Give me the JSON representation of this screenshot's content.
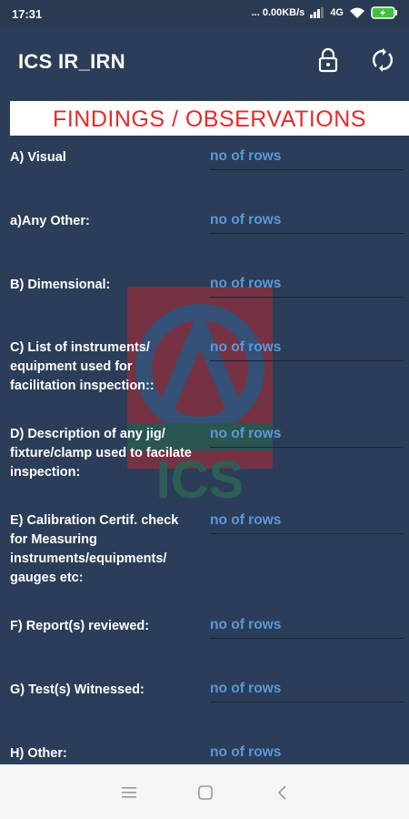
{
  "status_bar": {
    "time": "17:31",
    "network_speed": "... 0.00KB/s",
    "network_type": "4G"
  },
  "app_bar": {
    "title": "ICS IR_IRN",
    "actions": [
      "lock-icon",
      "sync-icon"
    ]
  },
  "banner": {
    "text": "FINDINGS / OBSERVATIONS",
    "color": "#e42b2b"
  },
  "fields": [
    {
      "label": "A) Visual",
      "link": "no of rows"
    },
    {
      "label": "a)Any Other:",
      "link": "no of rows"
    },
    {
      "label": "B) Dimensional:",
      "link": "no of rows"
    },
    {
      "label": "C) List of instruments/ equipment used for facilitation inspection::",
      "link": "no of rows"
    },
    {
      "label": "D) Description of any jig/ fixture/clamp used to facilate inspection:",
      "link": "no of rows"
    },
    {
      "label": "E) Calibration Certif. check for Measuring instruments/equipments/ gauges etc:",
      "link": "no of rows"
    },
    {
      "label": "F) Report(s) reviewed:",
      "link": "no of rows"
    },
    {
      "label": "G) Test(s) Witnessed:",
      "link": "no of rows"
    },
    {
      "label": "H) Other:",
      "link": "no of rows"
    }
  ],
  "watermark": {
    "text": "ICS"
  },
  "nav_bar": {
    "buttons": [
      "menu-icon",
      "home-icon",
      "back-icon"
    ]
  },
  "colors": {
    "background": "#2b3d58",
    "link": "#5c98da",
    "label": "#ffffff"
  }
}
